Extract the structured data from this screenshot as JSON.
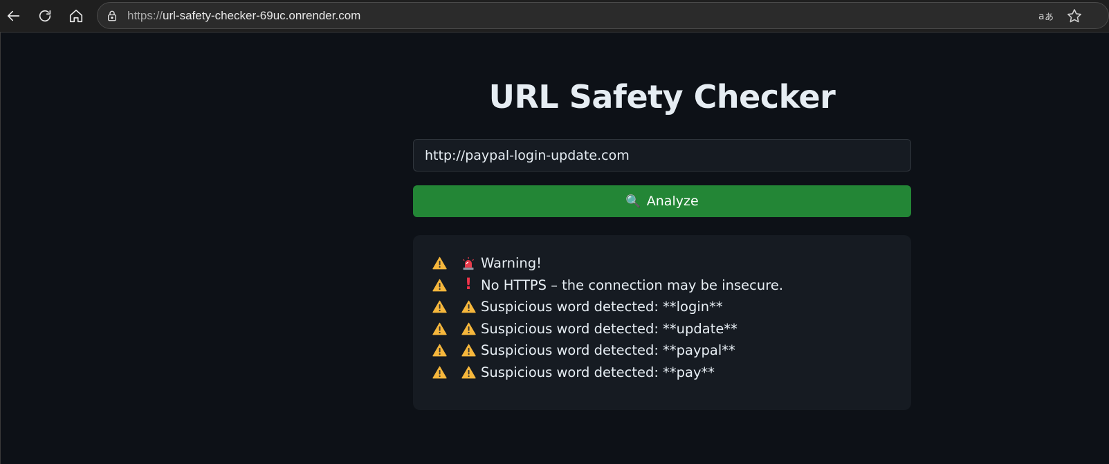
{
  "browser": {
    "url_protocol": "https://",
    "url_host": "url-safety-checker-69uc.onrender.com",
    "icons": [
      "back-icon",
      "reload-icon",
      "home-icon",
      "lock-icon",
      "translate-icon",
      "star-icon"
    ]
  },
  "page": {
    "title": "URL Safety Checker",
    "input_value": "http://paypal-login-update.com",
    "analyze_label": "Analyze",
    "analyze_icon": "🔍",
    "colors": {
      "background": "#0d1117",
      "panel": "#161b22",
      "button": "#238636",
      "warning": "#f6b73c",
      "alert": "#f0334a"
    }
  },
  "results": [
    {
      "bullet_icon": "warning-icon",
      "icon": "siren-icon",
      "text": "Warning!"
    },
    {
      "bullet_icon": "warning-icon",
      "icon": "exclamation-icon",
      "text": "No HTTPS – the connection may be insecure."
    },
    {
      "bullet_icon": "warning-icon",
      "icon": "warning-icon",
      "text": "Suspicious word detected: **login**"
    },
    {
      "bullet_icon": "warning-icon",
      "icon": "warning-icon",
      "text": "Suspicious word detected: **update**"
    },
    {
      "bullet_icon": "warning-icon",
      "icon": "warning-icon",
      "text": "Suspicious word detected: **paypal**"
    },
    {
      "bullet_icon": "warning-icon",
      "icon": "warning-icon",
      "text": "Suspicious word detected: **pay**"
    }
  ]
}
